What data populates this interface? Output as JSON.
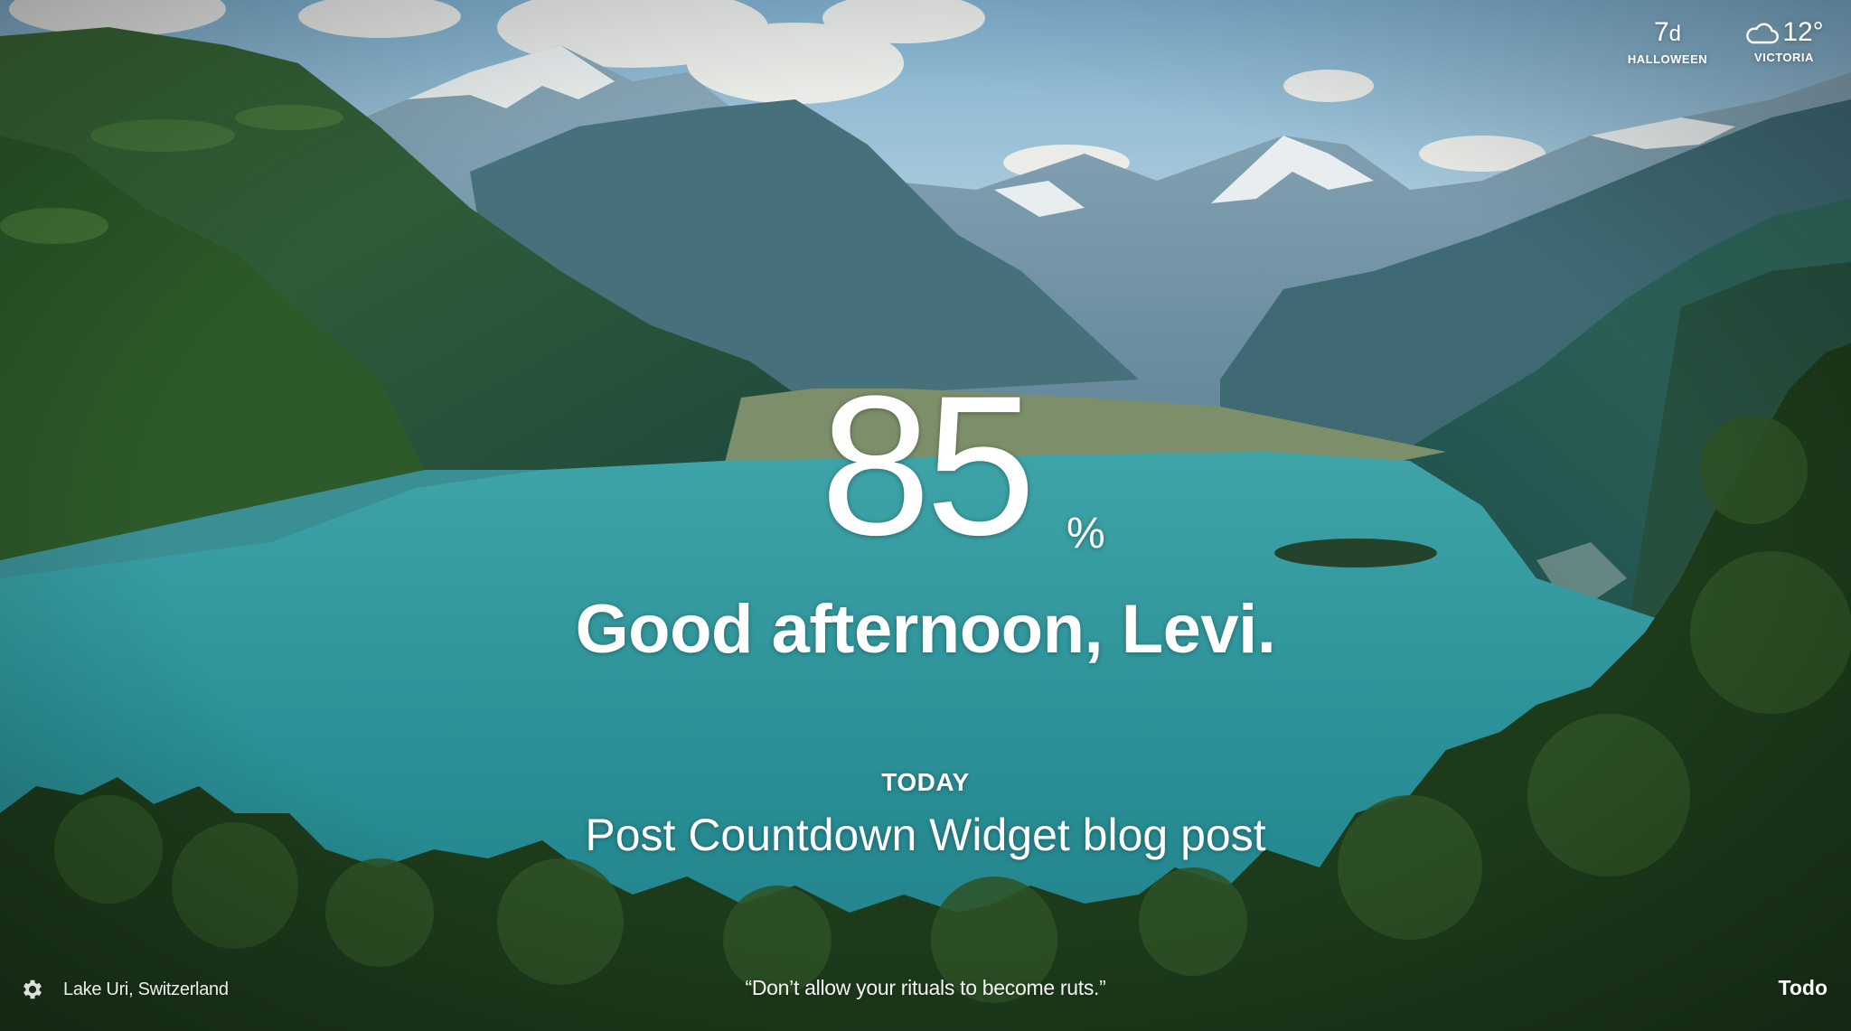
{
  "background": {
    "colors": {
      "sky": "#9ec4d8",
      "mountain_far": "#6f93a8",
      "mountain_mid": "#2f5f6b",
      "hill_green": "#2f5a2c",
      "lake": "#2f9aa0",
      "forest": "#1f3a1a"
    }
  },
  "widgets": {
    "countdown": {
      "value": "7",
      "unit": "d",
      "label": "HALLOWEEN"
    },
    "weather": {
      "icon": "cloud-icon",
      "temperature": "12°",
      "label": "VICTORIA"
    }
  },
  "center": {
    "big_number": "85",
    "percent_sign": "%",
    "greeting": "Good afternoon, Levi.",
    "focus": {
      "heading": "TODAY",
      "text": "Post Countdown Widget blog post"
    }
  },
  "bottom": {
    "settings_icon": "gear-icon",
    "location": "Lake Uri, Switzerland",
    "quote": "“Don’t allow your rituals to become ruts.”",
    "todo_label": "Todo"
  }
}
